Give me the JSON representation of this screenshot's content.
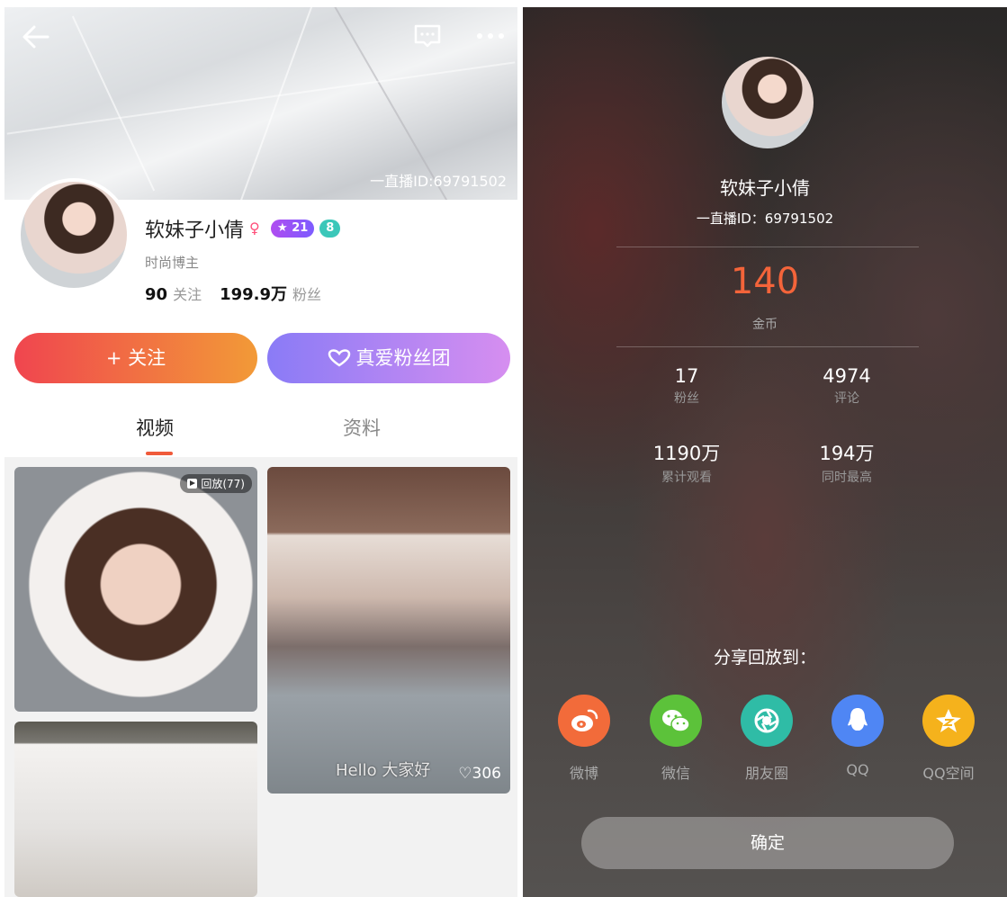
{
  "profile": {
    "room_id": "一直播ID:69791502",
    "name": "软妹子小倩",
    "level": "21",
    "badge": "8",
    "subtitle": "时尚博主",
    "following_count": "90",
    "following_label": "关注",
    "fans_count": "199.9万",
    "fans_label": "粉丝",
    "follow_label": "+ 关注",
    "fan_club_label": "真爱粉丝团"
  },
  "tabs": [
    "视频",
    "资料"
  ],
  "videos": [
    {
      "replay": "回放(77)"
    },
    {
      "caption": "Hello 大家好",
      "likes": "♡306"
    },
    {}
  ],
  "panel": {
    "name": "软妹子小倩",
    "room_id": "一直播ID：69791502",
    "coins": "140",
    "coins_label": "金币",
    "stats": [
      {
        "value": "17",
        "label": "粉丝"
      },
      {
        "value": "4974",
        "label": "评论"
      },
      {
        "value": "1190万",
        "label": "累计观看"
      },
      {
        "value": "194万",
        "label": "同时最高"
      }
    ],
    "share_title": "分享回放到：",
    "share_targets": [
      {
        "label": "微博",
        "icon": "weibo-icon",
        "color": "#f26b3a"
      },
      {
        "label": "微信",
        "icon": "wechat-icon",
        "color": "#5cc23a"
      },
      {
        "label": "朋友圈",
        "icon": "moments-icon",
        "color": "#2fbca6"
      },
      {
        "label": "QQ",
        "icon": "qq-icon",
        "color": "#4f86f4"
      },
      {
        "label": "QQ空间",
        "icon": "qzone-icon",
        "color": "#f5b21c"
      }
    ],
    "confirm_label": "确定"
  }
}
